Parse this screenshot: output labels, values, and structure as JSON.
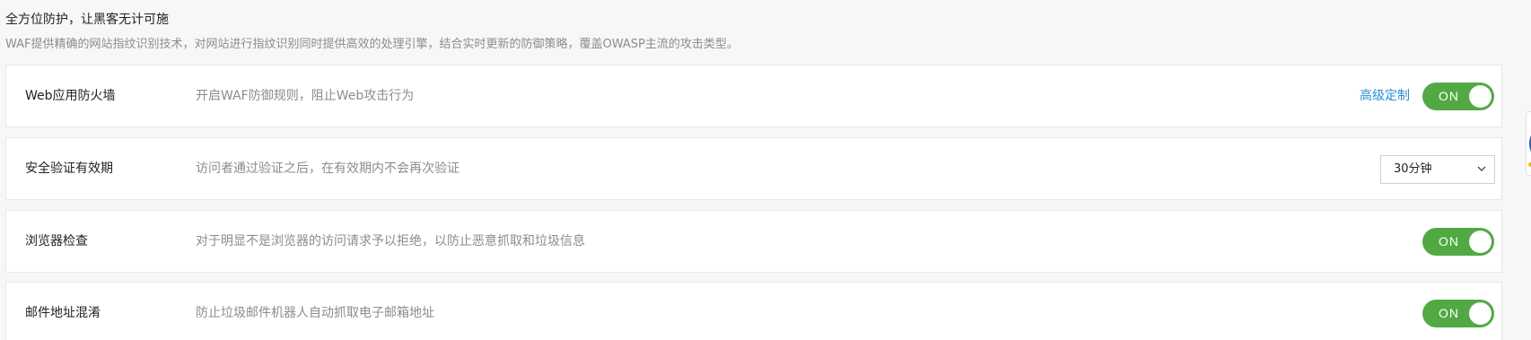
{
  "header": {
    "title": "全方位防护，让黑客无计可施",
    "description": "WAF提供精确的网站指纹识别技术，对网站进行指纹识别同时提供高效的处理引擎，结合实时更新的防御策略，覆盖OWASP主流的攻击类型。"
  },
  "rows": [
    {
      "title": "Web应用防火墙",
      "description": "开启WAF防御规则，阻止Web攻击行为",
      "link_label": "高级定制",
      "toggle_label": "ON",
      "toggle_state": "on"
    },
    {
      "title": "安全验证有效期",
      "description": "访问者通过验证之后，在有效期内不会再次验证",
      "select_value": "30分钟"
    },
    {
      "title": "浏览器检查",
      "description": "对于明显不是浏览器的访问请求予以拒绝，以防止恶意抓取和垃圾信息",
      "toggle_label": "ON",
      "toggle_state": "on"
    },
    {
      "title": "邮件地址混淆",
      "description": "防止垃圾邮件机器人自动抓取电子邮箱地址",
      "toggle_label": "ON",
      "toggle_state": "on"
    }
  ],
  "colors": {
    "toggle_on": "#52a944",
    "link": "#2a8fd6",
    "title_text": "#222222",
    "muted_text": "#8c8c8c"
  },
  "icons": {
    "select_arrow": "chevron-down-icon"
  }
}
